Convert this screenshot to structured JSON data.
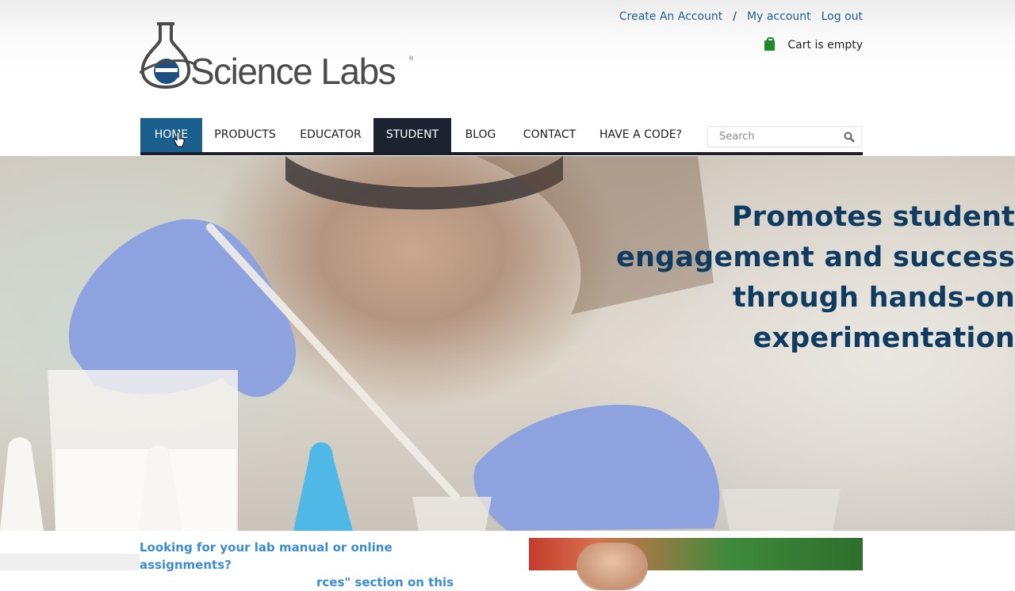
{
  "header": {
    "logo_text": "eScience Labs",
    "top_links": {
      "create_account": "Create An Account",
      "separator": "/",
      "my_account": "My account",
      "log_out": "Log out"
    },
    "cart": {
      "label": "Cart is empty",
      "icon": "shopping-bag-icon"
    }
  },
  "nav": {
    "items": [
      {
        "label": "HOME",
        "state": "active"
      },
      {
        "label": "PRODUCTS"
      },
      {
        "label": "EDUCATOR"
      },
      {
        "label": "STUDENT",
        "state": "highlighted"
      },
      {
        "label": "BLOG"
      },
      {
        "label": "CONTACT"
      },
      {
        "label": "HAVE A CODE?"
      }
    ],
    "search": {
      "placeholder": "Search",
      "icon": "search-icon"
    }
  },
  "hero": {
    "lines": [
      "Promotes student",
      "engagement and success",
      "through hands-on",
      "experimentation"
    ]
  },
  "below": {
    "callout_line1": "Looking for your lab manual or online assignments?",
    "callout_line2": "rces\" section on this"
  },
  "colors": {
    "accent_blue": "#1b5f8f",
    "nav_dark": "#1c2330",
    "hero_text": "#0f3b60",
    "link": "#1f5f8b",
    "callout": "#3b8ccf",
    "cart_green": "#1a8a2a"
  }
}
